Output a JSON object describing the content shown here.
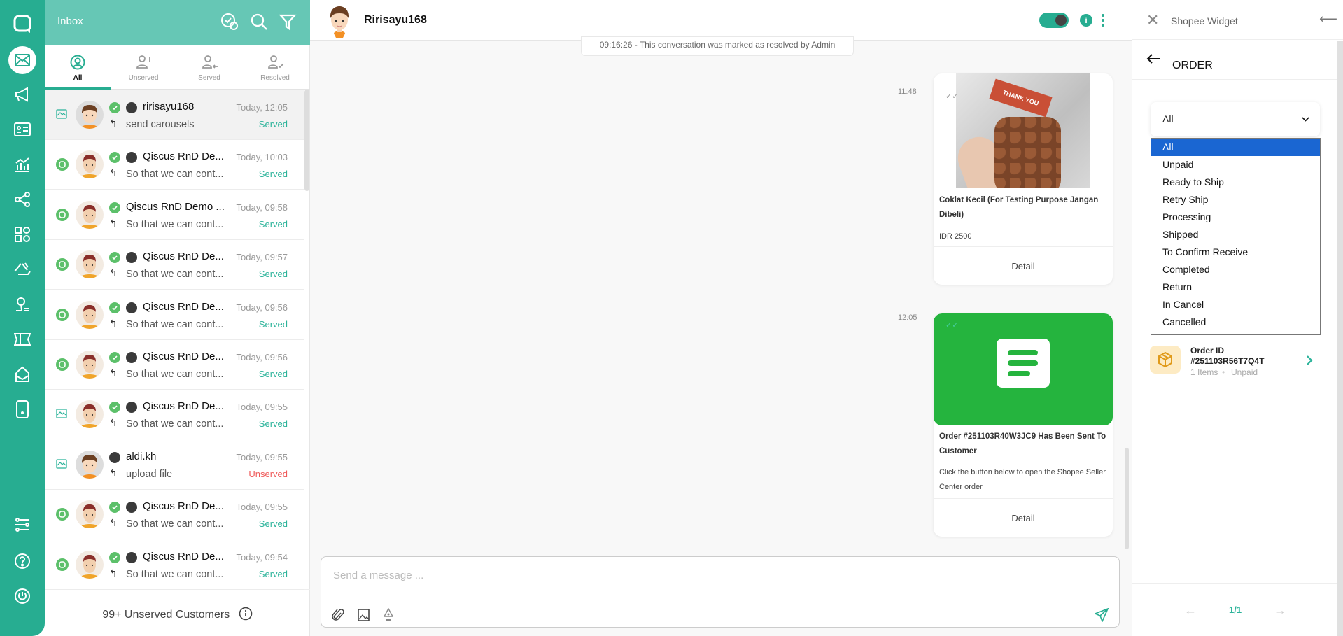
{
  "nav": {
    "items": [
      "logo",
      "inbox",
      "campaign",
      "contacts",
      "analytics",
      "integration",
      "apps",
      "channels",
      "agents",
      "tickets",
      "inbox-archive",
      "mobile",
      "settings",
      "help",
      "logout"
    ]
  },
  "inbox": {
    "title": "Inbox",
    "tabs": [
      {
        "label": "All"
      },
      {
        "label": "Unserved"
      },
      {
        "label": "Served"
      },
      {
        "label": "Resolved"
      }
    ],
    "items": [
      {
        "name": "ririsayu168",
        "preview": "send carousels",
        "time": "Today, 12:05",
        "status": "Served",
        "channel": "image",
        "checked": true,
        "shopee": true,
        "avatar": "boy"
      },
      {
        "name": "Qiscus RnD De...",
        "preview": "So that we can cont...",
        "time": "Today, 10:03",
        "status": "Served",
        "channel": "qiscus",
        "checked": true,
        "shopee": true,
        "avatar": "man"
      },
      {
        "name": "Qiscus RnD Demo ...",
        "preview": "So that we can cont...",
        "time": "Today, 09:58",
        "status": "Served",
        "channel": "qiscus",
        "checked": true,
        "shopee": false,
        "avatar": "man"
      },
      {
        "name": "Qiscus RnD De...",
        "preview": "So that we can cont...",
        "time": "Today, 09:57",
        "status": "Served",
        "channel": "qiscus",
        "checked": true,
        "shopee": true,
        "avatar": "man"
      },
      {
        "name": "Qiscus RnD De...",
        "preview": "So that we can cont...",
        "time": "Today, 09:56",
        "status": "Served",
        "channel": "qiscus",
        "checked": true,
        "shopee": true,
        "avatar": "man"
      },
      {
        "name": "Qiscus RnD De...",
        "preview": "So that we can cont...",
        "time": "Today, 09:56",
        "status": "Served",
        "channel": "qiscus",
        "checked": true,
        "shopee": true,
        "avatar": "man"
      },
      {
        "name": "Qiscus RnD De...",
        "preview": "So that we can cont...",
        "time": "Today, 09:55",
        "status": "Served",
        "channel": "image",
        "checked": true,
        "shopee": true,
        "avatar": "man"
      },
      {
        "name": "aldi.kh",
        "preview": "upload file",
        "time": "Today, 09:55",
        "status": "Unserved",
        "channel": "image",
        "checked": false,
        "shopee": true,
        "avatar": "boy"
      },
      {
        "name": "Qiscus RnD De...",
        "preview": "So that we can cont...",
        "time": "Today, 09:55",
        "status": "Served",
        "channel": "qiscus",
        "checked": true,
        "shopee": true,
        "avatar": "man"
      },
      {
        "name": "Qiscus RnD De...",
        "preview": "So that we can cont...",
        "time": "Today, 09:54",
        "status": "Served",
        "channel": "qiscus",
        "checked": true,
        "shopee": true,
        "avatar": "man"
      }
    ],
    "footer": "99+ Unserved Customers"
  },
  "chat": {
    "name": "Ririsayu168",
    "notice": "09:16:26 - This conversation was marked as resolved by Admin",
    "messages": [
      {
        "time": "11:48",
        "title": "Coklat Kecil (For Testing Purpose Jangan Dibeli)",
        "subtitle": "IDR 2500",
        "button": "Detail",
        "image_tag": "THANK YOU"
      },
      {
        "time": "12:05",
        "title": "Order #251103R40W3JC9 Has Been Sent To Customer",
        "subtitle": "Click the button below to open the Shopee Seller Center order",
        "button": "Detail"
      }
    ],
    "input_placeholder": "Send a message ..."
  },
  "widget": {
    "title": "Shopee Widget",
    "section": "ORDER",
    "select_value": "All",
    "options": [
      "All",
      "Unpaid",
      "Ready to Ship",
      "Retry Ship",
      "Processing",
      "Shipped",
      "To Confirm Receive",
      "Completed",
      "Return",
      "In Cancel",
      "Cancelled"
    ],
    "order": {
      "label": "Order ID",
      "id": "#251103R56T7Q4T",
      "items": "1 Items",
      "status": "Unpaid"
    },
    "page": "1/1"
  },
  "colors": {
    "primary": "#27ad91",
    "header": "#66c7b5",
    "served": "#2bb39a",
    "unserved": "#ef5a5a",
    "card_green": "#25b43e",
    "highlight": "#1a66d2"
  }
}
